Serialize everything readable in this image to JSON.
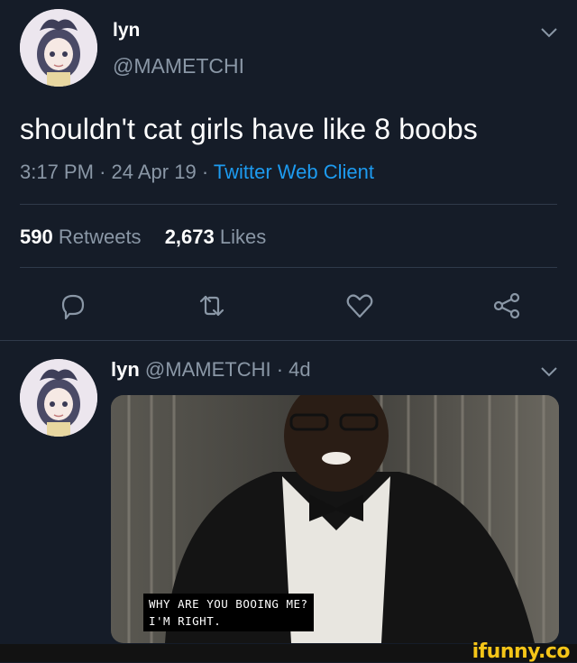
{
  "tweet": {
    "display_name": "lyn",
    "handle": "@MAMETCHI",
    "text": "shouldn't cat girls have like 8 boobs",
    "time": "3:17 PM",
    "date": "24 Apr 19",
    "client": "Twitter Web Client",
    "retweets_count": "590",
    "retweets_label": "Retweets",
    "likes_count": "2,673",
    "likes_label": "Likes"
  },
  "reply": {
    "display_name": "lyn",
    "handle": "@MAMETCHI",
    "age": "4d",
    "subtitle_line1": "WHY ARE YOU BOOING ME?",
    "subtitle_line2": "I'M RIGHT."
  },
  "watermark": "ifunny.co",
  "separator": "·",
  "icons": [
    "chevron-down-icon",
    "reply-icon",
    "retweet-icon",
    "like-icon",
    "share-icon"
  ]
}
